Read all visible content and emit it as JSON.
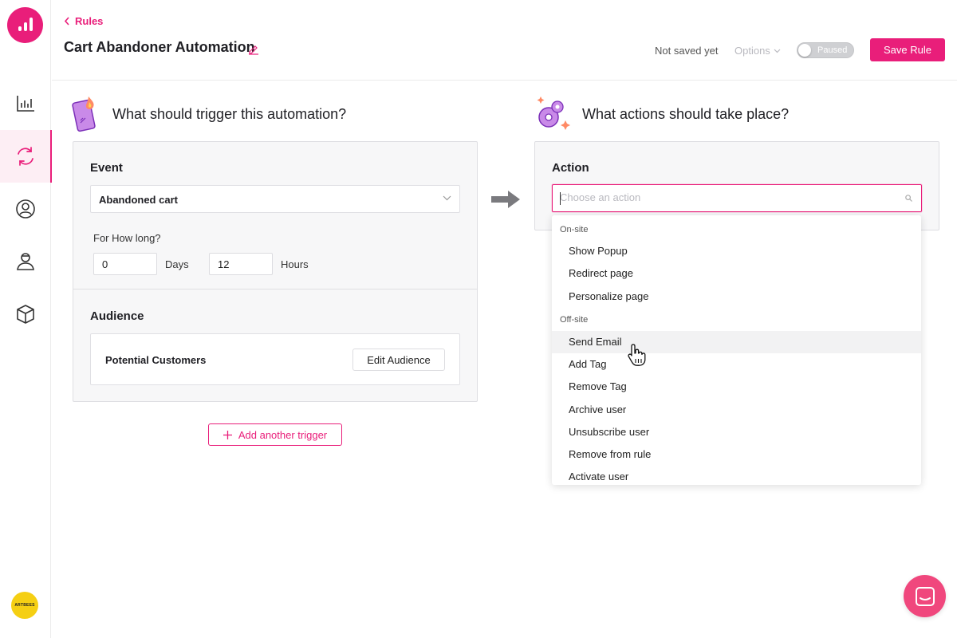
{
  "sidebar": {
    "items": [
      {
        "name": "analytics",
        "icon": "bar-chart-icon"
      },
      {
        "name": "rules",
        "icon": "refresh-cycle-icon",
        "active": true
      },
      {
        "name": "users",
        "icon": "user-circle-icon"
      },
      {
        "name": "profiles",
        "icon": "person-icon"
      },
      {
        "name": "products",
        "icon": "cube-icon"
      }
    ],
    "avatar_text": "ARTBEES"
  },
  "header": {
    "back_label": "Rules",
    "title": "Cart Abandoner Automation",
    "save_status": "Not saved yet",
    "options_label": "Options",
    "toggle_label": "Paused",
    "save_button": "Save Rule"
  },
  "trigger": {
    "heading": "What should trigger this automation?",
    "event_label": "Event",
    "event_value": "Abandoned cart",
    "duration_label": "For How long?",
    "days_value": "0",
    "days_label": "Days",
    "hours_value": "12",
    "hours_label": "Hours",
    "audience_label": "Audience",
    "audience_name": "Potential Customers",
    "edit_audience": "Edit Audience",
    "add_trigger": "Add another trigger"
  },
  "action": {
    "heading": "What actions should take place?",
    "label": "Action",
    "placeholder": "Choose an action",
    "groups": [
      {
        "title": "On-site",
        "options": [
          "Show Popup",
          "Redirect page",
          "Personalize page"
        ]
      },
      {
        "title": "Off-site",
        "options": [
          "Send Email",
          "Add Tag",
          "Remove Tag",
          "Archive user",
          "Unsubscribe user",
          "Remove from rule",
          "Activate user"
        ]
      }
    ],
    "hovered_option": "Send Email"
  },
  "colors": {
    "accent": "#e91e7a",
    "chat": "#f0477d",
    "avatar": "#f5cf13"
  }
}
